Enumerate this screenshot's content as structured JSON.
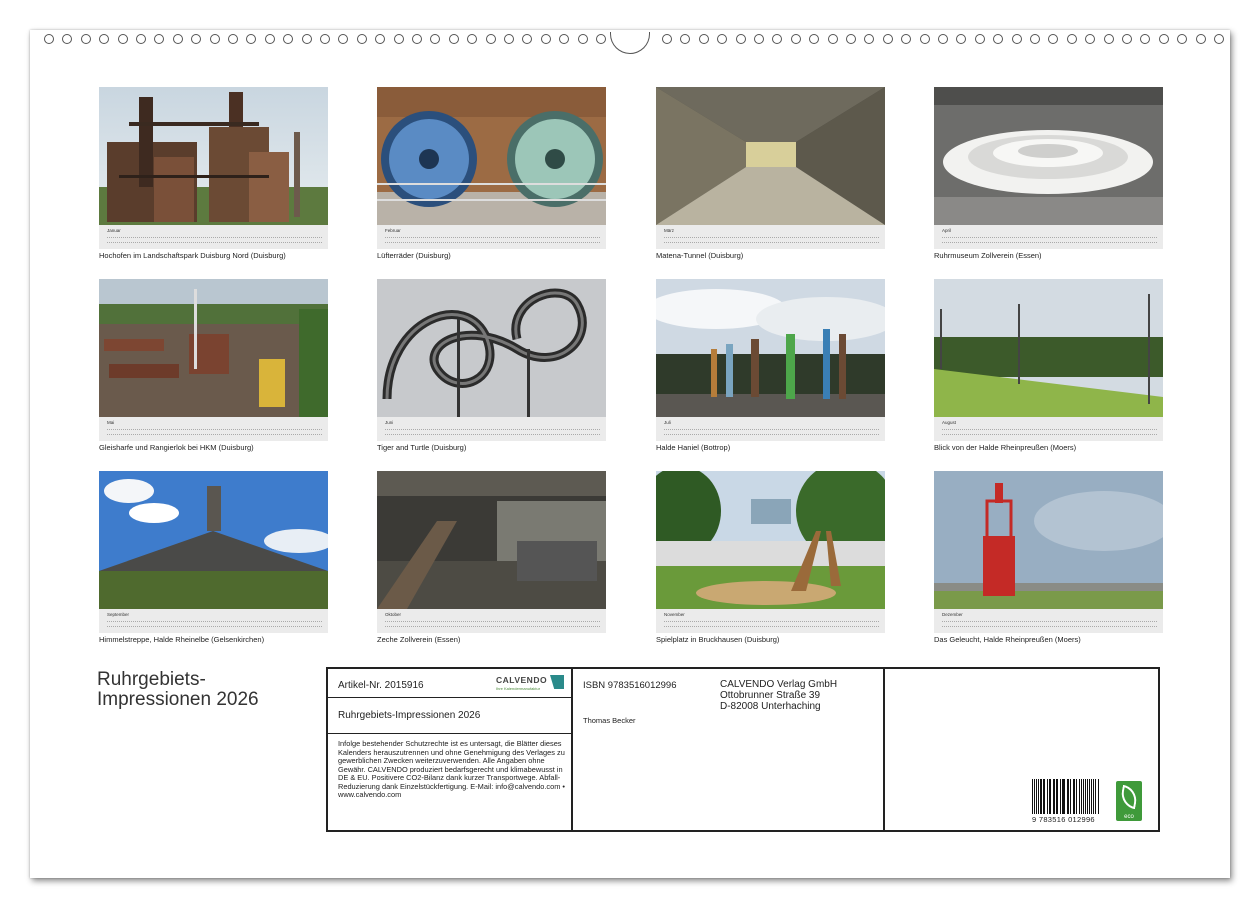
{
  "months": [
    {
      "month": "Januar",
      "caption": "Hochofen im Landschaftspark Duisburg Nord (Duisburg)"
    },
    {
      "month": "Februar",
      "caption": "Lüfterräder (Duisburg)"
    },
    {
      "month": "März",
      "caption": "Matena-Tunnel (Duisburg)"
    },
    {
      "month": "April",
      "caption": "Ruhrmuseum Zollverein (Essen)"
    },
    {
      "month": "Mai",
      "caption": "Gleisharfe und Rangierlok bei HKM (Duisburg)"
    },
    {
      "month": "Juni",
      "caption": "Tiger and Turtle (Duisburg)"
    },
    {
      "month": "Juli",
      "caption": "Halde Haniel (Bottrop)"
    },
    {
      "month": "August",
      "caption": "Blick von der Halde Rheinpreußen (Moers)"
    },
    {
      "month": "September",
      "caption": "Himmelstreppe, Halde Rheinelbe (Gelsenkirchen)"
    },
    {
      "month": "Oktober",
      "caption": "Zeche Zollverein (Essen)"
    },
    {
      "month": "November",
      "caption": "Spielplatz in Bruckhausen (Duisburg)"
    },
    {
      "month": "Dezember",
      "caption": "Das Geleucht, Halde Rheinpreußen (Moers)"
    }
  ],
  "title_line1": "Ruhrgebiets-",
  "title_line2": "Impressionen 2026",
  "info": {
    "artikel": "Artikel-Nr. 2015916",
    "logo_text": "CALVENDO",
    "logo_sub": "Ihre Kalendermanufaktur",
    "calendar_title": "Ruhrgebiets-Impressionen 2026",
    "legal": "Infolge bestehender Schutzrechte ist es untersagt, die Blätter dieses Kalenders herauszutrennen und ohne Genehmigung des Verlages zu gewerblichen Zwecken weiterzuverwenden. Alle Angaben ohne Gewähr. CALVENDO produziert bedarfsgerecht und klimabewusst in DE & EU. Positivere CO2-Bilanz dank kurzer Transportwege. Abfall-Reduzierung dank Einzelstückfertigung. E-Mail: info@calvendo.com • www.calvendo.com",
    "isbn": "ISBN 9783516012996",
    "author": "Thomas Becker",
    "publisher_name": "CALVENDO Verlag GmbH",
    "publisher_street": "Ottobrunner Straße 39",
    "publisher_city": "D-82008 Unterhaching",
    "barcode_number": "9 783516 012996",
    "eco_label": "eco"
  }
}
